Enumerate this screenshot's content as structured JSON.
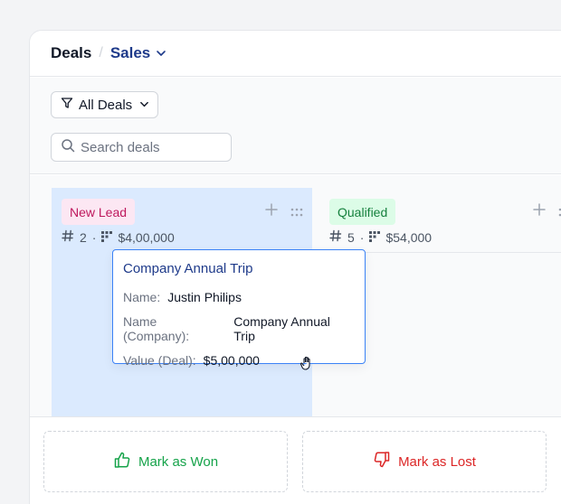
{
  "header": {
    "root_label": "Deals",
    "separator": "/",
    "current_label": "Sales"
  },
  "toolbar": {
    "filter_label": "All Deals",
    "search_placeholder": "Search deals"
  },
  "columns": [
    {
      "label": "New Lead",
      "count": "2",
      "amount": "$4,00,000",
      "color": "#be185d",
      "bg": "#fce7f3"
    },
    {
      "label": "Qualified",
      "count": "5",
      "amount": "$54,000",
      "color": "#15803d",
      "bg": "#dcfce7"
    }
  ],
  "card": {
    "title": "Company Annual Trip",
    "rows": [
      {
        "key": "Name:",
        "value": "Justin Philips"
      },
      {
        "key": "Name (Company):",
        "value": "Company Annual Trip"
      },
      {
        "key": "Value (Deal):",
        "value": "$5,00,000"
      }
    ]
  },
  "actions": {
    "won_label": "Mark as Won",
    "lost_label": "Mark as Lost"
  },
  "colors": {
    "accent": "#1e3a8a",
    "drop_zone": "#dbeafe",
    "card_border": "#3b82f6",
    "won": "#16a34a",
    "lost": "#dc2626"
  },
  "icons": [
    "chevron-down-icon",
    "filter-icon",
    "search-icon",
    "hash-icon",
    "currency-icon",
    "plus-icon",
    "drag-handle-icon",
    "thumbs-up-icon",
    "thumbs-down-icon",
    "grab-cursor-icon"
  ]
}
